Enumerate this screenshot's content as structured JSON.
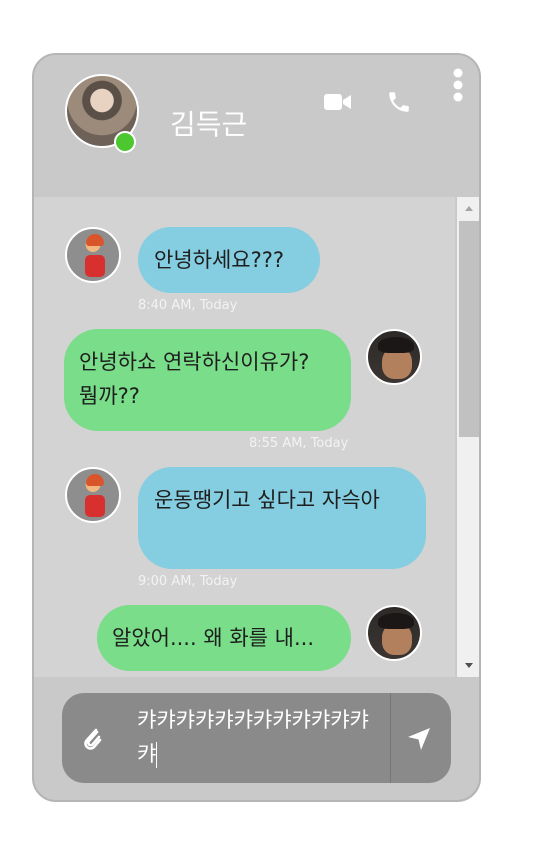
{
  "contact": {
    "name": "김득근",
    "status_color": "#4cc72f"
  },
  "header_icons": {
    "video": "video-camera-icon",
    "phone": "phone-icon",
    "menu": "more-vertical-icon"
  },
  "messages": [
    {
      "side": "left",
      "text": "안녕하세요???",
      "time": "8:40 AM, Today",
      "avatar": "cartoon-boy"
    },
    {
      "side": "right",
      "text": "안녕하쇼 연락하신이유가?뭠까??",
      "time": "8:55 AM, Today",
      "avatar": "man"
    },
    {
      "side": "left",
      "text": "운동땡기고 싶다고 자슥아",
      "time": "9:00 AM, Today",
      "avatar": "cartoon-boy"
    },
    {
      "side": "right",
      "text": "알았어.... 왜 화를 내...",
      "time": "",
      "avatar": "man"
    }
  ],
  "composer": {
    "value": "캬캬캬캬캬캬캬캬캬캬캬캬캬",
    "attach_icon": "paperclip-icon",
    "send_icon": "send-icon"
  },
  "colors": {
    "incoming": "#85cde0",
    "outgoing": "#79dd8a",
    "panel": "#c9c9c9",
    "messages_bg": "#d3d3d3"
  }
}
